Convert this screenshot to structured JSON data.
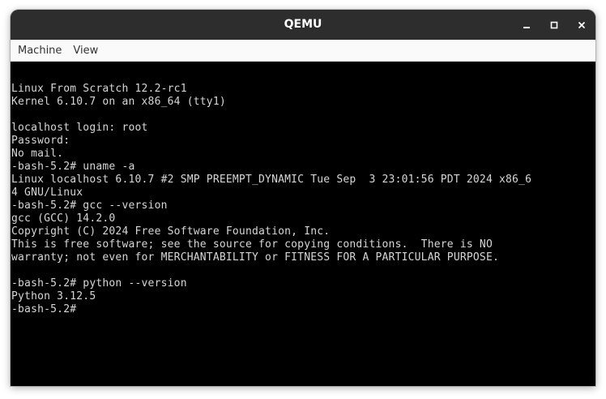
{
  "window": {
    "title": "QEMU"
  },
  "title_controls": {
    "minimize_icon": "minimize-icon",
    "maximize_icon": "maximize-icon",
    "close_icon": "close-icon"
  },
  "menu": {
    "items": [
      "Machine",
      "View"
    ]
  },
  "console": {
    "lines": [
      "Linux From Scratch 12.2-rc1",
      "Kernel 6.10.7 on an x86_64 (tty1)",
      "",
      "localhost login: root",
      "Password:",
      "No mail.",
      "-bash-5.2# uname -a",
      "Linux localhost 6.10.7 #2 SMP PREEMPT_DYNAMIC Tue Sep  3 23:01:56 PDT 2024 x86_6",
      "4 GNU/Linux",
      "-bash-5.2# gcc --version",
      "gcc (GCC) 14.2.0",
      "Copyright (C) 2024 Free Software Foundation, Inc.",
      "This is free software; see the source for copying conditions.  There is NO",
      "warranty; not even for MERCHANTABILITY or FITNESS FOR A PARTICULAR PURPOSE.",
      "",
      "-bash-5.2# python --version",
      "Python 3.12.5",
      "-bash-5.2#"
    ]
  }
}
